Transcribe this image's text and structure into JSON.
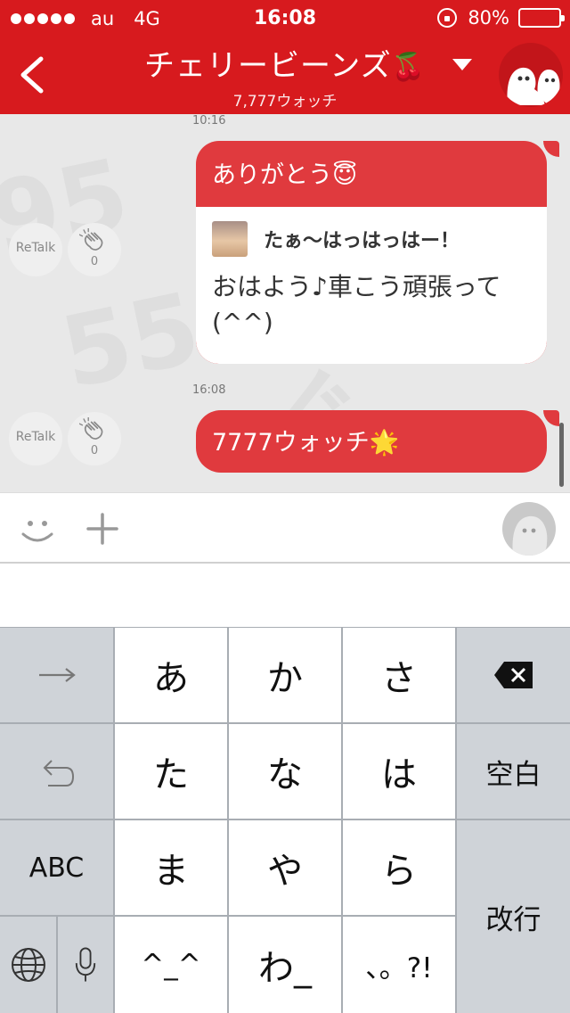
{
  "status_bar": {
    "carrier": "au",
    "network": "4G",
    "time": "16:08",
    "battery_percent": "80%",
    "battery_level": 0.8,
    "signal_icon": "signal-dots-icon",
    "rotation_lock_icon": "rotation-lock-icon"
  },
  "header": {
    "title": "チェリービーンズ",
    "title_emoji": "🍒",
    "watch_count": "7,777ウォッチ",
    "back_icon": "chevron-left-icon",
    "dropdown_icon": "triangle-down-icon",
    "color": "#d71a1e"
  },
  "chat": {
    "messages": [
      {
        "timestamp": "10:16",
        "text": "ありがとう",
        "emoji": "😇",
        "quote": {
          "name": "たぁ〜はっはっはー！",
          "text": "おはよう♪車こう頑張って(^^)"
        },
        "retalk_label": "ReTalk",
        "clap_count": "0"
      },
      {
        "timestamp": "16:08",
        "text": "7777ウォッチ",
        "emoji": "🌟",
        "retalk_label": "ReTalk",
        "clap_count": "0"
      }
    ],
    "bubble_color": "#e03a3e"
  },
  "input_bar": {
    "emoji_icon": "smiley-icon",
    "plus_icon": "plus-icon",
    "avatar_icon": "user-avatar-icon"
  },
  "keyboard": {
    "rows": [
      [
        "→",
        "あ",
        "か",
        "さ",
        "⌫"
      ],
      [
        "↺",
        "た",
        "な",
        "は",
        "空白"
      ],
      [
        "ABC",
        "ま",
        "や",
        "ら",
        "改行"
      ],
      [
        "🌐",
        "🎤",
        "^^",
        "わ",
        "、。?!"
      ]
    ],
    "labels": {
      "next": "→",
      "a": "あ",
      "ka": "か",
      "sa": "さ",
      "ta": "た",
      "na": "な",
      "ha": "は",
      "space": "空白",
      "abc": "ABC",
      "ma": "ま",
      "ya": "や",
      "ra": "ら",
      "return": "改行",
      "kaomoji": "^_^",
      "wa": "わ_",
      "punct": "、。?!"
    }
  }
}
